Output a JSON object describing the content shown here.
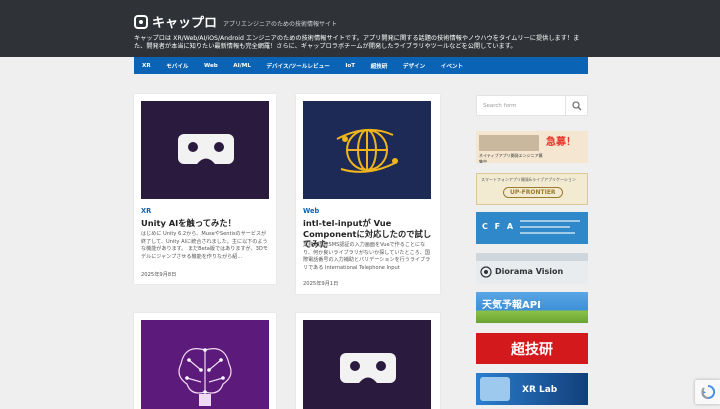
{
  "site": {
    "logo_text": "キャップロ",
    "tagline": "アプリエンジニアのための技術情報サイト",
    "description": "キャップロは XR/Web/AI/iOS/Android エンジニアのための技術情報サイトです。アプリ開発に関する話題の技術情報やノウハウをタイムリーに提供します！また、開発者が本当に知りたい最新情報も完全網羅！さらに、ギャップロラボチームが開発したライブラリやツールなどを公開しています。"
  },
  "nav": {
    "items": [
      "XR",
      "モバイル",
      "Web",
      "AI/ML",
      "デバイス/ツールレビュー",
      "IoT",
      "超技研",
      "デザイン",
      "イベント"
    ]
  },
  "posts": [
    {
      "category": "XR",
      "title": "Unity AIを触ってみた！",
      "excerpt": "はじめに Unity 6.2から、MuseやSentisのサービスが終了して、Unity AIに統合されました。主に以下のような機能があります。 まだBeta版ではありますが、3Dモデルにジャンプさせる機能を作りながら紹...",
      "date": "2025年9月8日",
      "thumb": "vr-headset"
    },
    {
      "category": "Web",
      "title": "intl-tel-inputが Vue Componentに対応したので試してみた",
      "excerpt": "業務で国際SMS認証の入力画面をVueで作ることになり、何か良いライブラリがないか探していたところ、国際電話番号の入力補助とバリデーションを行うライブラリである International Telephone Input",
      "date": "2025年9月1日",
      "thumb": "globe"
    },
    {
      "thumb": "brain"
    },
    {
      "thumb": "vr-headset"
    }
  ],
  "sidebar": {
    "search_placeholder": "Search form",
    "ads": [
      {
        "name": "recruit-banner",
        "text": "急募！",
        "sub": "ネイティブアプリ開発エンジニア募集中",
        "bg": "#f4e6d0",
        "accent": "#e8392c"
      },
      {
        "name": "up-frontier-banner",
        "text": "UP-FRONTIER",
        "sub": "スマートフォンアプリ開発&ライブアプリケーション",
        "bg": "#f3ead2",
        "accent": "#9b7b2e"
      },
      {
        "name": "cfa-banner",
        "text": "C F A",
        "sub": "",
        "bg": "#2f88c9",
        "accent": "#ffffff"
      },
      {
        "name": "diorama-vision-banner",
        "text": "Diorama Vision",
        "sub": "",
        "bg": "#e9ecef",
        "accent": "#2f3337"
      },
      {
        "name": "weather-api-banner",
        "text": "天気予報API",
        "sub": "",
        "bg": "#3d8fd6",
        "accent": "#ffffff"
      },
      {
        "name": "choginken-banner",
        "text": "超技研",
        "sub": "",
        "bg": "#d4191d",
        "accent": "#ffffff"
      },
      {
        "name": "xr-lab-banner",
        "text": "XR Lab",
        "sub": "",
        "bg": "#123f7a",
        "accent": "#ffffff"
      }
    ]
  },
  "colors": {
    "header": "#2f3337",
    "nav": "#0b63b6",
    "category": "#0b63b6",
    "thumb_dark": "#2a1a3d",
    "thumb_navy": "#1c2a55",
    "thumb_purple": "#5c1a7a"
  }
}
